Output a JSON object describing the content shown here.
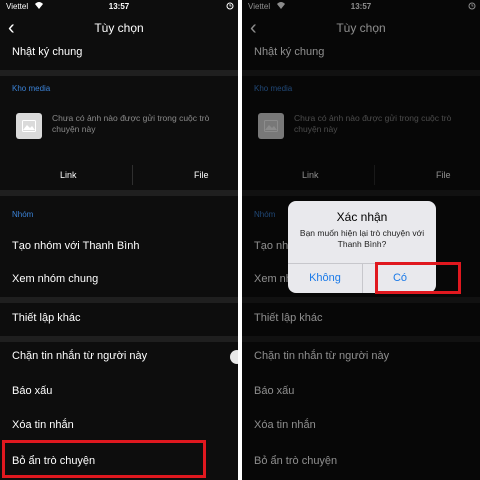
{
  "status_bar": {
    "carrier": "Viettel",
    "time": "13:57"
  },
  "header": {
    "back_glyph": "‹",
    "title": "Tùy chọn"
  },
  "colors": {
    "accent": "#3b82d6",
    "highlight": "#e0181f",
    "dialog_button": "#1b7ae8"
  },
  "rows": {
    "shared_log": "Nhật ký chung",
    "media_section": "Kho media",
    "media_empty": "Chưa có ảnh nào được gửi trong cuộc trò chuyện này",
    "tab_link": "Link",
    "tab_file": "File",
    "group_section": "Nhóm",
    "create_group": "Tạo nhóm với Thanh Bình",
    "common_groups": "Xem nhóm chung",
    "other_settings": "Thiết lập khác",
    "block_messages": "Chặn tin nhắn từ người này",
    "report": "Báo xấu",
    "delete_messages": "Xóa tin nhắn",
    "unhide_chat": "Bỏ ẩn trò chuyện"
  },
  "dialog": {
    "title": "Xác nhận",
    "message": "Bạn muốn hiện lại trò chuyện với Thanh Bình?",
    "no_label": "Không",
    "yes_label": "Có"
  }
}
